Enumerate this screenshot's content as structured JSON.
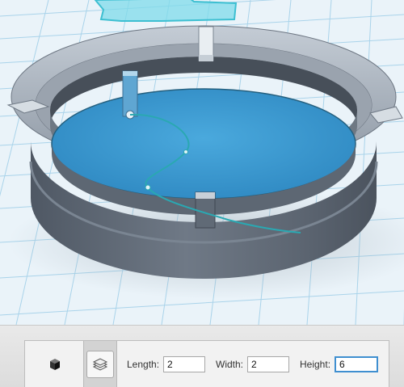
{
  "viewport": {
    "colors": {
      "background": "#eaf3f9",
      "grid": "#a9d3ea",
      "ring_dark": "#5a6470",
      "ring_light": "#aeb7c1",
      "water": "#3d9bd0",
      "wire": "#2aa8b2",
      "selection_outline": "#5fd2e2"
    }
  },
  "toolbar": {
    "solid_tool_icon": "cube-icon",
    "layers_tool_icon": "layers-icon",
    "length_label": "Length:",
    "length_value": "2",
    "width_label": "Width:",
    "width_value": "2",
    "height_label": "Height:",
    "height_value": "6"
  }
}
